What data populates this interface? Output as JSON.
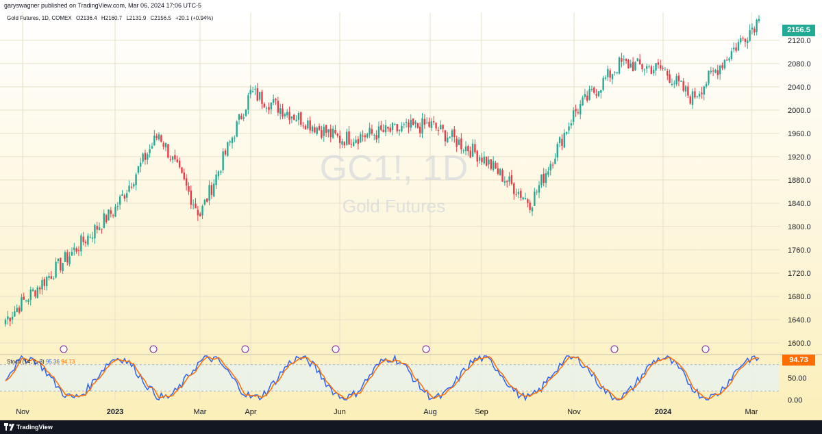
{
  "header": {
    "publisher": "garyswagner published on TradingView.com, Mar 06, 2024 17:06 UTC-5"
  },
  "legend": {
    "symbol": "Gold Futures, 1D, COMEX",
    "open": "O2136.4",
    "high": "H2160.7",
    "low": "L2131.9",
    "close": "C2156.5",
    "change": "+20.1 (+0.94%)"
  },
  "watermark": {
    "ticker": "GC1!, 1D",
    "name": "Gold Futures"
  },
  "price_tag": "2156.5",
  "stoch": {
    "label": "Stoch (14, 1, 3)",
    "k_value": "95.36",
    "d_value": "94.73",
    "tag": "94.73"
  },
  "footer": {
    "brand": "TradingView"
  },
  "colors": {
    "up": "#22ab94",
    "down": "#f23645",
    "k_line": "#2962ff",
    "d_line": "#ff6d00",
    "stoch_band": "#e8f4ef"
  },
  "chart_data": {
    "type": "candlestick",
    "title": "Gold Futures, 1D, COMEX",
    "x_tick_labels": [
      "Nov",
      "2023",
      "Mar",
      "Apr",
      "Jun",
      "Aug",
      "Sep",
      "Nov",
      "2024",
      "Mar"
    ],
    "y_tick_labels": [
      "1600.0",
      "1640.0",
      "1680.0",
      "1720.0",
      "1760.0",
      "1800.0",
      "1840.0",
      "1880.0",
      "1920.0",
      "1960.0",
      "2000.0",
      "2040.0",
      "2080.0",
      "2120.0"
    ],
    "ylim": [
      1580,
      2168
    ],
    "key_close_values": [
      {
        "date": "Nov",
        "value": 1640
      },
      {
        "date": "2023",
        "value": 1830
      },
      {
        "date": "Jan end",
        "value": 1960
      },
      {
        "date": "Mar",
        "value": 1820
      },
      {
        "date": "Apr",
        "value": 2030
      },
      {
        "date": "Jun",
        "value": 1950
      },
      {
        "date": "Aug",
        "value": 1975
      },
      {
        "date": "Sep",
        "value": 1920
      },
      {
        "date": "Oct",
        "value": 1840
      },
      {
        "date": "Nov",
        "value": 1995
      },
      {
        "date": "Dec",
        "value": 2080
      },
      {
        "date": "2024",
        "value": 2070
      },
      {
        "date": "Feb",
        "value": 2020
      },
      {
        "date": "Mar",
        "value": 2156.5
      }
    ],
    "last_close": 2156.5,
    "stochastic": {
      "name": "Stoch (14, 1, 3)",
      "y_tick_labels": [
        "0.00",
        "50.00"
      ],
      "ylim": [
        0,
        100
      ],
      "last_k": 95.36,
      "last_d": 94.73
    }
  }
}
